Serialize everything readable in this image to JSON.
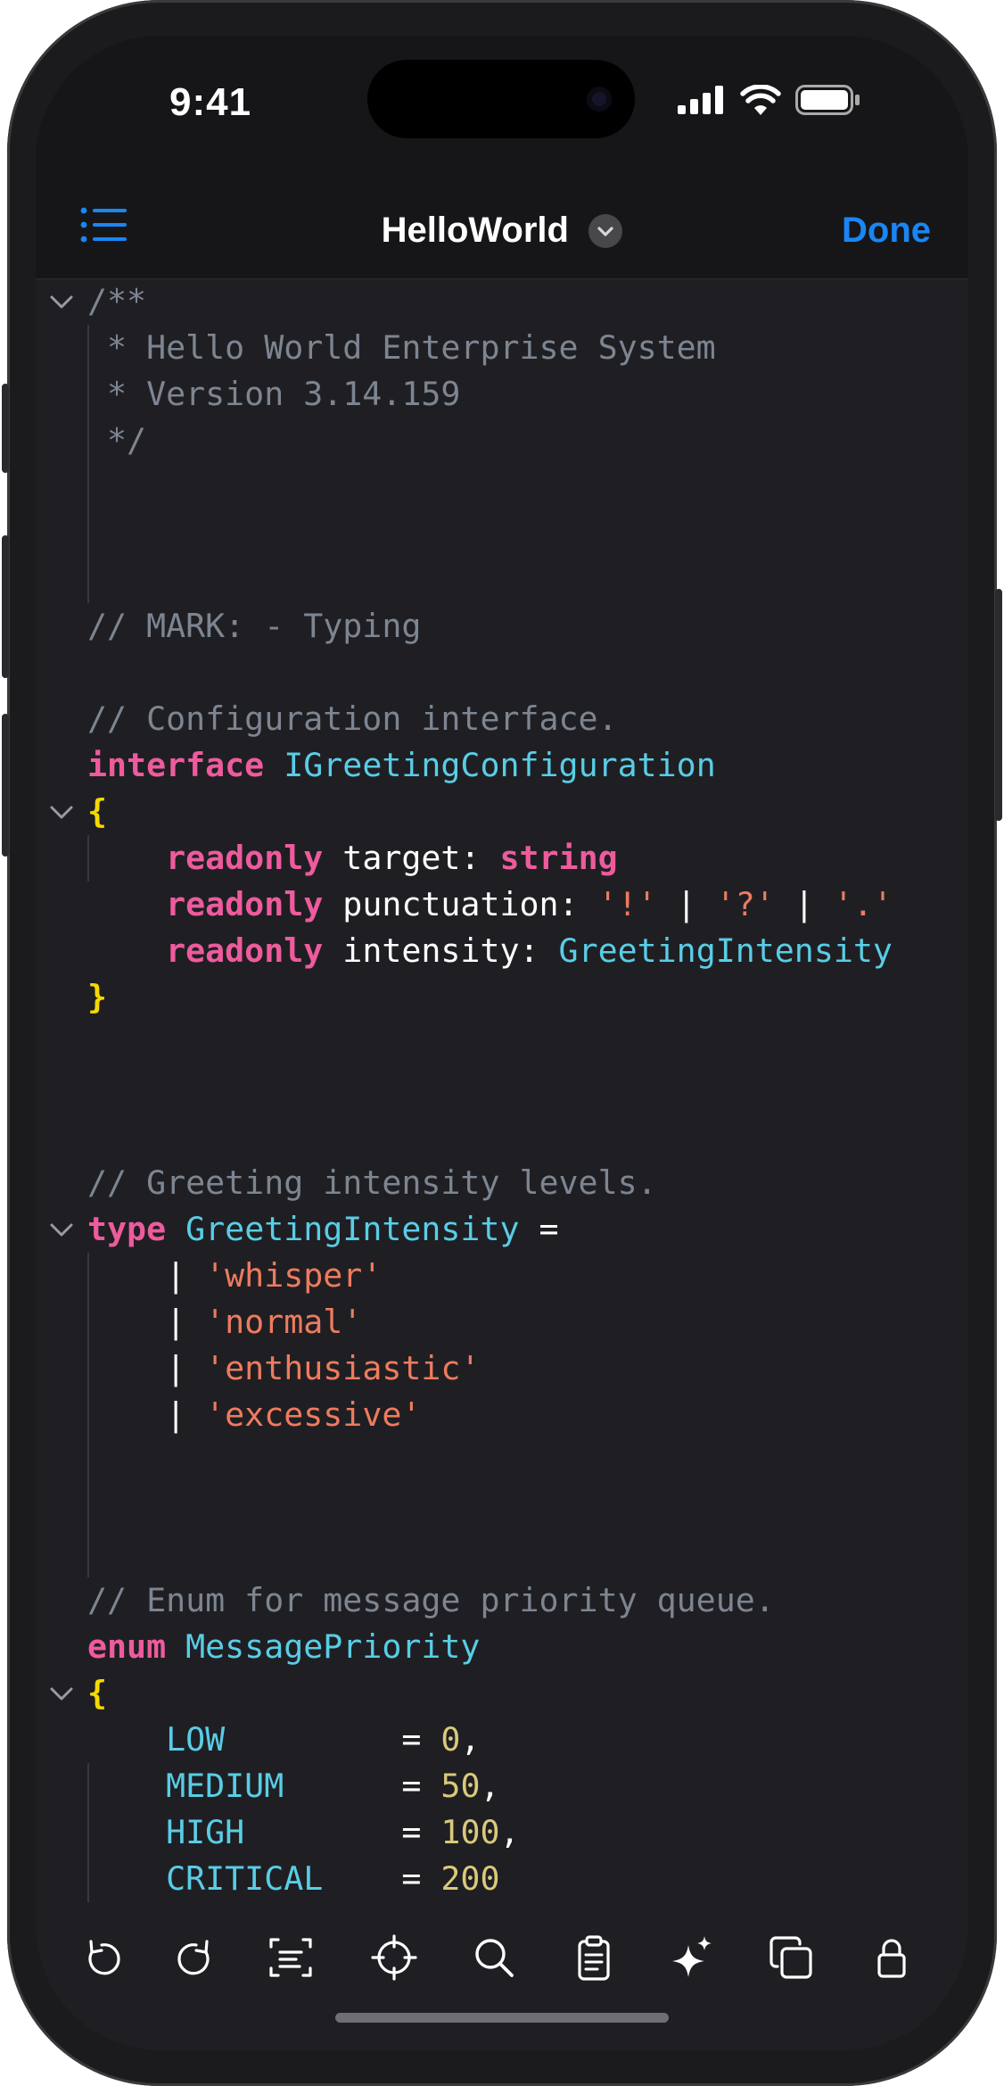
{
  "status_bar": {
    "time": "9:41"
  },
  "nav": {
    "title": "HelloWorld",
    "done_label": "Done"
  },
  "accent_color": "#1a86f4",
  "editor": {
    "lines": [
      [
        {
          "c": "c",
          "t": "/**"
        }
      ],
      [
        {
          "c": "c",
          "t": " * Hello World Enterprise System"
        }
      ],
      [
        {
          "c": "c",
          "t": " * Version 3.14.159"
        }
      ],
      [
        {
          "c": "c",
          "t": " */"
        }
      ],
      [],
      [],
      [],
      [
        {
          "c": "c",
          "t": "// MARK: - Typing"
        }
      ],
      [],
      [
        {
          "c": "c",
          "t": "// Configuration interface."
        }
      ],
      [
        {
          "c": "k",
          "t": "interface"
        },
        {
          "c": "w",
          "t": " "
        },
        {
          "c": "t",
          "t": "IGreetingConfiguration"
        }
      ],
      [
        {
          "c": "y",
          "t": "{"
        }
      ],
      [
        {
          "c": "w",
          "t": "    "
        },
        {
          "c": "k",
          "t": "readonly"
        },
        {
          "c": "w",
          "t": " target: "
        },
        {
          "c": "k",
          "t": "string"
        }
      ],
      [
        {
          "c": "w",
          "t": "    "
        },
        {
          "c": "k",
          "t": "readonly"
        },
        {
          "c": "w",
          "t": " punctuation: "
        },
        {
          "c": "s",
          "t": "'!'"
        },
        {
          "c": "w",
          "t": " | "
        },
        {
          "c": "s",
          "t": "'?'"
        },
        {
          "c": "w",
          "t": " | "
        },
        {
          "c": "s",
          "t": "'.'"
        }
      ],
      [
        {
          "c": "w",
          "t": "    "
        },
        {
          "c": "k",
          "t": "readonly"
        },
        {
          "c": "w",
          "t": " intensity: "
        },
        {
          "c": "t",
          "t": "GreetingIntensity"
        }
      ],
      [
        {
          "c": "y",
          "t": "}"
        }
      ],
      [],
      [],
      [],
      [
        {
          "c": "c",
          "t": "// Greeting intensity levels."
        }
      ],
      [
        {
          "c": "k",
          "t": "type"
        },
        {
          "c": "w",
          "t": " "
        },
        {
          "c": "t",
          "t": "GreetingIntensity"
        },
        {
          "c": "w",
          "t": " ="
        }
      ],
      [
        {
          "c": "w",
          "t": "    | "
        },
        {
          "c": "s",
          "t": "'whisper'"
        }
      ],
      [
        {
          "c": "w",
          "t": "    | "
        },
        {
          "c": "s",
          "t": "'normal'"
        }
      ],
      [
        {
          "c": "w",
          "t": "    | "
        },
        {
          "c": "s",
          "t": "'enthusiastic'"
        }
      ],
      [
        {
          "c": "w",
          "t": "    | "
        },
        {
          "c": "s",
          "t": "'excessive'"
        }
      ],
      [],
      [],
      [],
      [
        {
          "c": "c",
          "t": "// Enum for message priority queue."
        }
      ],
      [
        {
          "c": "k",
          "t": "enum"
        },
        {
          "c": "w",
          "t": " "
        },
        {
          "c": "t",
          "t": "MessagePriority"
        }
      ],
      [
        {
          "c": "y",
          "t": "{"
        }
      ],
      [
        {
          "c": "t",
          "t": "    LOW"
        },
        {
          "c": "w",
          "t": "         = "
        },
        {
          "c": "n",
          "t": "0"
        },
        {
          "c": "w",
          "t": ","
        }
      ],
      [
        {
          "c": "t",
          "t": "    MEDIUM"
        },
        {
          "c": "w",
          "t": "      = "
        },
        {
          "c": "n",
          "t": "50"
        },
        {
          "c": "w",
          "t": ","
        }
      ],
      [
        {
          "c": "t",
          "t": "    HIGH"
        },
        {
          "c": "w",
          "t": "        = "
        },
        {
          "c": "n",
          "t": "100"
        },
        {
          "c": "w",
          "t": ","
        }
      ],
      [
        {
          "c": "t",
          "t": "    CRITICAL"
        },
        {
          "c": "w",
          "t": "    = "
        },
        {
          "c": "n",
          "t": "200"
        }
      ]
    ],
    "fold_markers_at_lines": [
      0,
      11,
      20,
      30
    ]
  },
  "toolbar": {
    "icons": [
      "undo-icon",
      "redo-icon",
      "text-select-icon",
      "goto-line-icon",
      "search-icon",
      "paste-icon",
      "sparkles-icon",
      "duplicate-icon",
      "lock-icon"
    ]
  }
}
